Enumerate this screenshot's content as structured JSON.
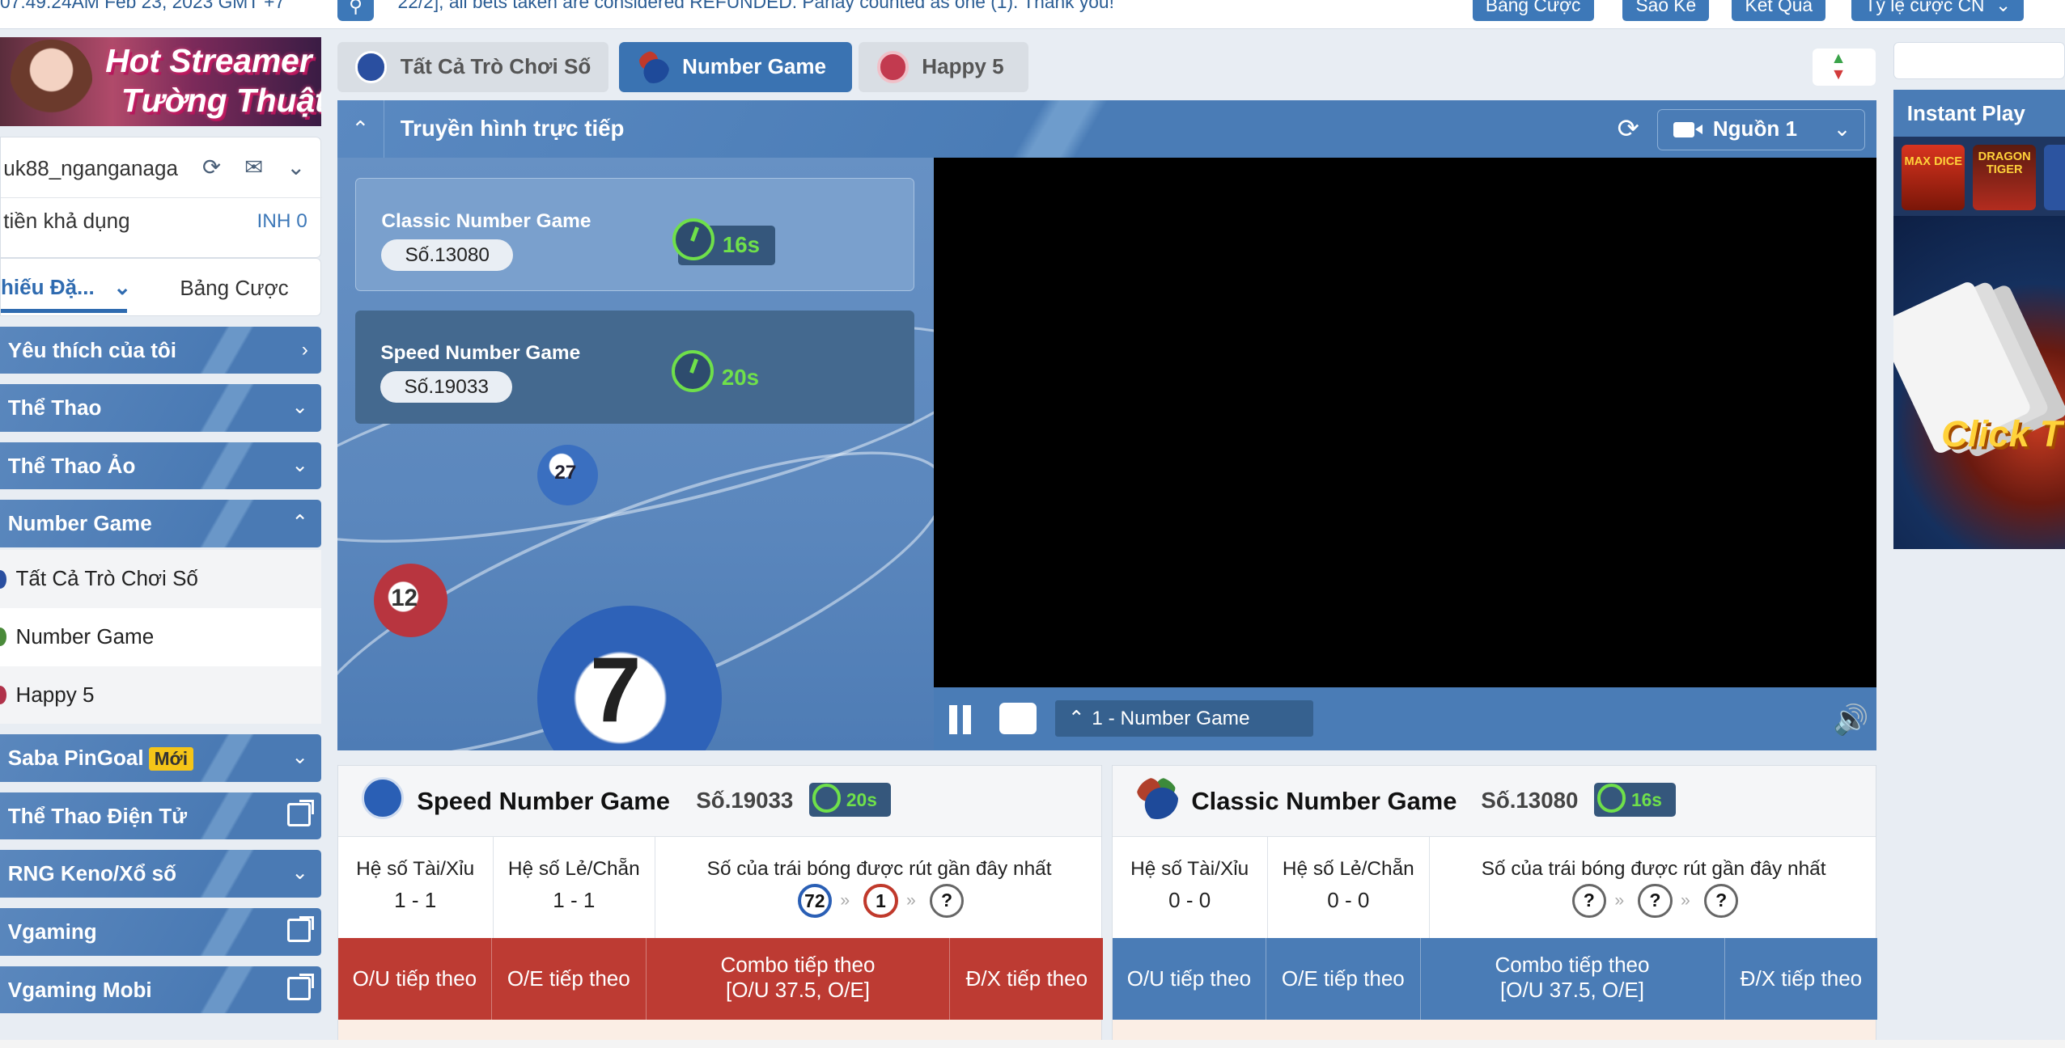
{
  "topbar": {
    "time": "07:49:24AM Feb 23, 2023 GMT +7",
    "marquee": "22/2], all bets taken are considered REFUNDED. Parlay counted as one (1). Thank you!",
    "buttons": [
      "Bảng Cược",
      "Sao Kê",
      "Kết Quả",
      "Tỷ lệ cược CN"
    ]
  },
  "banner": {
    "line1": "Hot Streamer",
    "line2": "Tường Thuật"
  },
  "user": {
    "name": "uk88_nganganaga",
    "balance_label": "tiền khả dụng",
    "balance_value": "INH 0"
  },
  "side_tabs": {
    "active": "hiếu Đặ...",
    "other": "Bảng Cược"
  },
  "sidebar": [
    {
      "label": "Yêu thích của tôi",
      "icon": "chevron-right-icon",
      "badge": ""
    },
    {
      "label": "Thể Thao",
      "icon": "chevron-down-icon",
      "badge": ""
    },
    {
      "label": "Thể Thao Ảo",
      "icon": "chevron-down-icon",
      "badge": ""
    },
    {
      "label": "Number Game",
      "icon": "chevron-up-icon",
      "badge": ""
    },
    {
      "label": "Saba PinGoal",
      "icon": "chevron-down-icon",
      "badge": "Mới"
    },
    {
      "label": "Thể Thao Điện Tử",
      "icon": "external-link-icon",
      "badge": ""
    },
    {
      "label": "RNG Keno/Xổ số",
      "icon": "chevron-down-icon",
      "badge": ""
    },
    {
      "label": "Vgaming",
      "icon": "external-link-icon",
      "badge": ""
    },
    {
      "label": "Vgaming Mobi",
      "icon": "external-link-icon",
      "badge": ""
    }
  ],
  "submenu": [
    "Tất Cả Trò Chơi Số",
    "Number Game",
    "Happy 5"
  ],
  "game_tabs": [
    "Tất Cả Trò Chơi Số",
    "Number Game",
    "Happy 5"
  ],
  "live": {
    "title": "Truyền hình trực tiếp",
    "source": "Nguồn 1",
    "channel": "1 - Number Game"
  },
  "cards": [
    {
      "name": "Classic Number Game",
      "no": "Số.13080",
      "timer": "16s"
    },
    {
      "name": "Speed Number Game",
      "no": "Số.19033",
      "timer": "20s"
    }
  ],
  "ball_numbers": [
    "27",
    "12",
    "7"
  ],
  "boards": [
    {
      "name": "Speed Number Game",
      "no": "Số.19033",
      "timer": "20s",
      "ou_label": "Hệ số Tài/Xỉu",
      "ou_value": "1 - 1",
      "oe_label": "Hệ số Lẻ/Chẵn",
      "oe_value": "1 - 1",
      "drawn_label": "Số của trái bóng được rút gần đây nhất",
      "balls": [
        "72",
        "1",
        "?"
      ],
      "bets": [
        "O/U tiếp theo",
        "O/E tiếp theo",
        "Combo tiếp theo",
        "[O/U 37.5, O/E]",
        "Đ/X tiếp theo"
      ],
      "color": "#bd3b33"
    },
    {
      "name": "Classic Number Game",
      "no": "Số.13080",
      "timer": "16s",
      "ou_label": "Hệ số Tài/Xỉu",
      "ou_value": "0 - 0",
      "oe_label": "Hệ số Lẻ/Chẵn",
      "oe_value": "0 - 0",
      "drawn_label": "Số của trái bóng được rút gần đây nhất",
      "balls": [
        "?",
        "?",
        "?"
      ],
      "bets": [
        "O/U tiếp theo",
        "O/E tiếp theo",
        "Combo tiếp theo",
        "[O/U 37.5, O/E]",
        "Đ/X tiếp theo"
      ],
      "color": "#4a7cb6"
    }
  ],
  "instant_play": {
    "title": "Instant Play",
    "thumbs": [
      "MAX DICE",
      "DRAGON TIGER"
    ],
    "promo": "Click T"
  }
}
